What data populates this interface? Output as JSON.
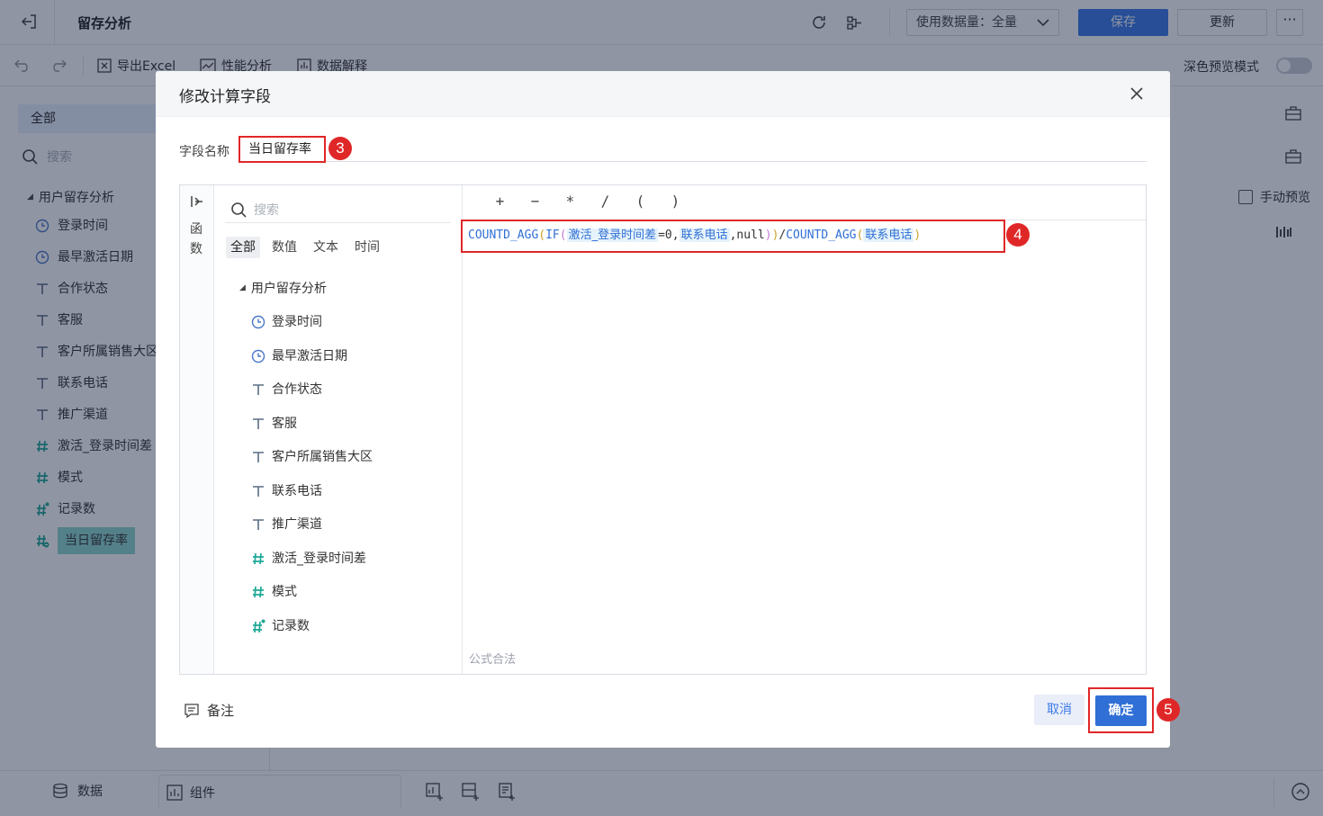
{
  "app": {
    "title": "留存分析",
    "data_volume_label": "使用数据量：全量",
    "save_label": "保存",
    "update_label": "更新",
    "more_label": "···",
    "export_excel": "导出Excel",
    "perf_analysis": "性能分析",
    "data_explain": "数据解释",
    "dark_preview": "深色预览模式",
    "manual_preview": "手动预览"
  },
  "left_panel": {
    "tab_all": "全部",
    "search_placeholder": "搜索",
    "group": "用户留存分析",
    "items": [
      {
        "label": "登录时间",
        "icon": "clock-icon"
      },
      {
        "label": "最早激活日期",
        "icon": "clock-icon"
      },
      {
        "label": "合作状态",
        "icon": "text-field-icon"
      },
      {
        "label": "客服",
        "icon": "text-field-icon"
      },
      {
        "label": "客户所属销售大区",
        "icon": "text-field-icon"
      },
      {
        "label": "联系电话",
        "icon": "text-field-icon"
      },
      {
        "label": "推广渠道",
        "icon": "text-field-icon"
      },
      {
        "label": "激活_登录时间差",
        "icon": "number-field-icon"
      },
      {
        "label": "模式",
        "icon": "number-field-icon"
      },
      {
        "label": "记录数",
        "icon": "record-count-icon"
      },
      {
        "label": "当日留存率",
        "icon": "calc-field-icon"
      }
    ]
  },
  "bottom_bar": {
    "data_tab": "数据",
    "component_tab": "组件"
  },
  "dialog": {
    "title": "修改计算字段",
    "field_name_label": "字段名称",
    "field_name_value": "当日留存率",
    "fn_label": [
      "函",
      "数"
    ],
    "search_placeholder": "搜索",
    "chips": [
      "全部",
      "数值",
      "文本",
      "时间"
    ],
    "group": "用户留存分析",
    "fields": [
      {
        "label": "登录时间",
        "icon": "clock-icon"
      },
      {
        "label": "最早激活日期",
        "icon": "clock-icon"
      },
      {
        "label": "合作状态",
        "icon": "text-field-icon"
      },
      {
        "label": "客服",
        "icon": "text-field-icon"
      },
      {
        "label": "客户所属销售大区",
        "icon": "text-field-icon"
      },
      {
        "label": "联系电话",
        "icon": "text-field-icon"
      },
      {
        "label": "推广渠道",
        "icon": "text-field-icon"
      },
      {
        "label": "激活_登录时间差",
        "icon": "number-field-icon"
      },
      {
        "label": "模式",
        "icon": "number-field-icon"
      },
      {
        "label": "记录数",
        "icon": "record-count-icon"
      }
    ],
    "operators": [
      "+",
      "−",
      "*",
      "/",
      "(",
      ")"
    ],
    "formula": {
      "fn1": "COUNTD_AGG",
      "open1": "(",
      "fn2": "IF",
      "open2": "(",
      "field1": "激活_登录时间差",
      "mid1": "=0,",
      "field2": "联系电话",
      "mid2": ",null",
      "close2": ")",
      "close1": ")",
      "slash": "/",
      "fn3": "COUNTD_AGG",
      "open3": "(",
      "field3": "联系电话",
      "close3": ")"
    },
    "valid_text": "公式合法",
    "note_label": "备注",
    "cancel_label": "取消",
    "ok_label": "确定"
  },
  "annotations": {
    "badge_3": "3",
    "badge_4": "4",
    "badge_5": "5"
  },
  "colors": {
    "primary": "#2f6fd6",
    "highlight_red": "#e02727",
    "number_icon": "#1ea896"
  }
}
